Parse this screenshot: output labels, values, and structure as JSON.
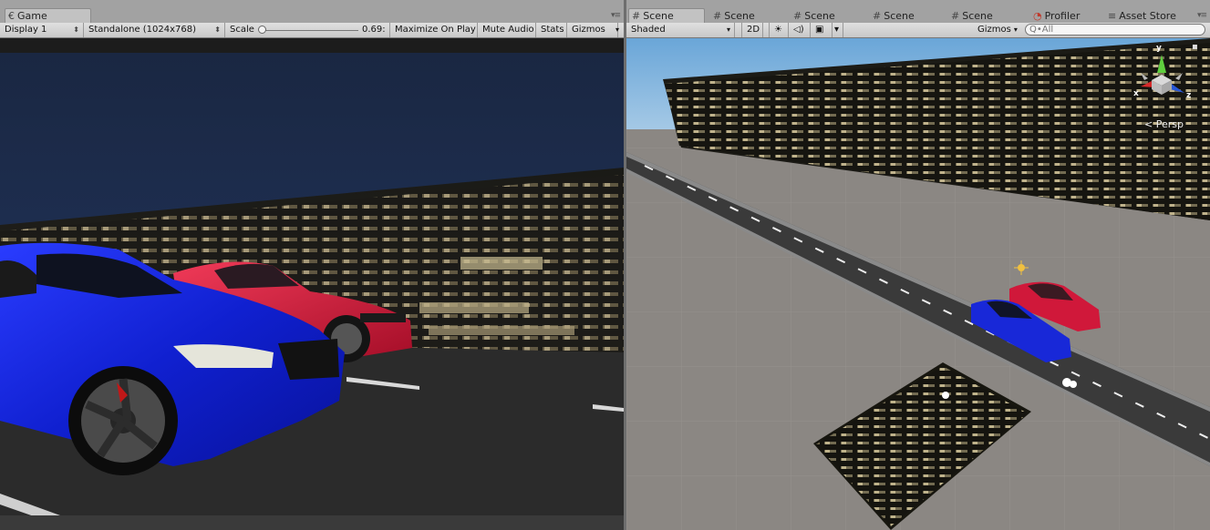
{
  "game": {
    "tab": {
      "icon": "game-controller-icon",
      "glyph": "€",
      "label": "Game"
    },
    "toolbar": {
      "display": "Display 1",
      "resolution": "Standalone (1024x768)",
      "scale_label": "Scale",
      "scale_value": "0.69:",
      "scale_fraction": 0.0,
      "maximize": "Maximize On Play",
      "mute": "Mute Audio",
      "stats": "Stats",
      "gizmos": "Gizmos"
    }
  },
  "scene": {
    "tabs": [
      {
        "icon": "scene-grid-icon",
        "glyph": "#",
        "label": "Scene"
      },
      {
        "icon": "scene-grid-icon",
        "glyph": "#",
        "label": "Scene"
      },
      {
        "icon": "scene-grid-icon",
        "glyph": "#",
        "label": "Scene"
      },
      {
        "icon": "scene-grid-icon",
        "glyph": "#",
        "label": "Scene"
      },
      {
        "icon": "scene-grid-icon",
        "glyph": "#",
        "label": "Scene"
      },
      {
        "icon": "profiler-icon",
        "glyph": "◔",
        "label": "Profiler"
      },
      {
        "icon": "asset-store-icon",
        "glyph": "≡",
        "label": "Asset Store"
      }
    ],
    "toolbar": {
      "shading": "Shaded",
      "mode_2d": "2D",
      "lighting_glyph": "☀",
      "audio_glyph": "◁)",
      "effects_glyph": "▣",
      "gizmos": "Gizmos",
      "search_placeholder": "Q•All"
    },
    "gizmo": {
      "y": "y",
      "x": "x",
      "z": "z",
      "projection": "< Persp"
    }
  },
  "colors": {
    "sky_night": "#1f2e4d",
    "car_blue": "#1424d8",
    "car_red": "#d21a3a",
    "road": "#2a2a2a",
    "ground_scene": "#8a8682",
    "sky_scene": "#8fbfe6"
  }
}
